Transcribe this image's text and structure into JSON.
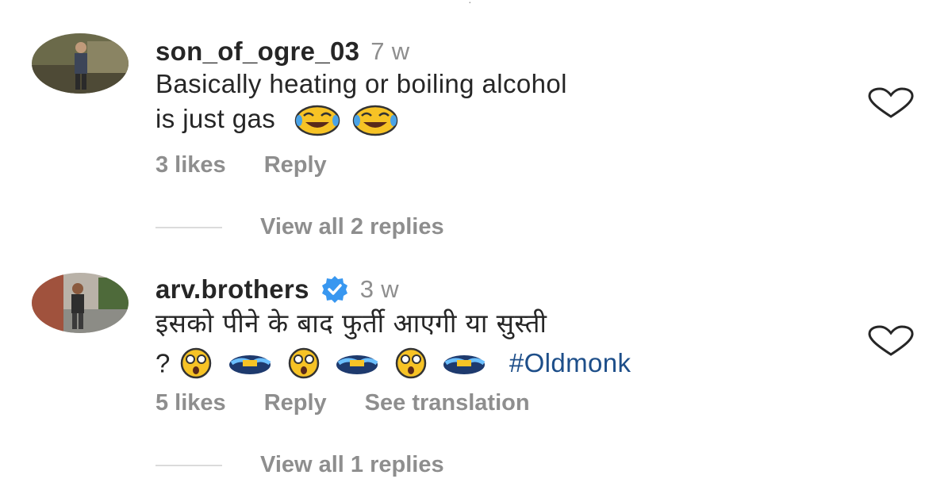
{
  "comments": [
    {
      "username": "son_of_ogre_03",
      "time": "7 w",
      "verified": false,
      "line1": "Basically heating or boiling alcohol",
      "line2": "is just gas",
      "likes": "3 likes",
      "reply": "Reply",
      "view_replies": "View all 2 replies"
    },
    {
      "username": "arv.brothers",
      "time": "3 w",
      "verified": true,
      "line1": "इसको पीने के बाद फुर्ती आएगी या सुस्ती",
      "line2_prefix": "?",
      "hashtag": "#Oldmonk",
      "likes": "5 likes",
      "reply": "Reply",
      "translate": "See translation",
      "view_replies": "View all 1 replies"
    }
  ],
  "icons": {
    "like": "heart-outline-icon",
    "verified": "verified-badge-icon",
    "laugh": "face-with-tears-of-joy-emoji",
    "dizzy": "dizzy-face-emoji",
    "dash": "dashing-away-emoji"
  },
  "colors": {
    "text": "#262626",
    "muted": "#8e8e8e",
    "hashtag": "#1d4e89",
    "verified": "#3897f0",
    "divider": "#dbdbdb"
  }
}
